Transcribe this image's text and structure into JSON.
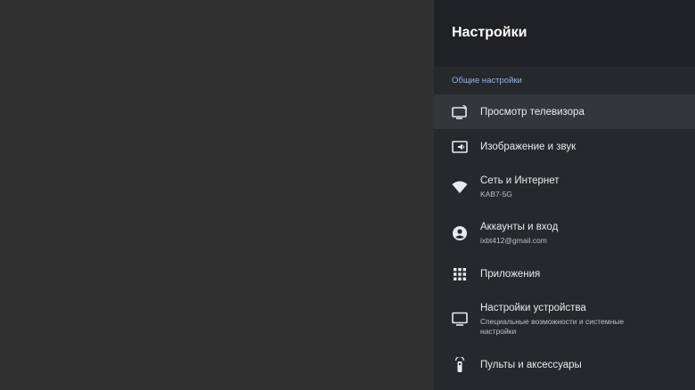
{
  "panel": {
    "title": "Настройки",
    "section_label": "Общие настройки"
  },
  "items": [
    {
      "label": "Просмотр телевизора",
      "icon": "tv-input-icon"
    },
    {
      "label": "Изображение и звук",
      "icon": "picture-sound-icon"
    },
    {
      "label": "Сеть и Интернет",
      "sub": "KAB7-5G",
      "icon": "wifi-icon"
    },
    {
      "label": "Аккаунты и вход",
      "sub": "ixbt412@gmail.com",
      "icon": "account-icon"
    },
    {
      "label": "Приложения",
      "icon": "apps-grid-icon"
    },
    {
      "label": "Настройки устройства",
      "sub": "Специальные возможности и системные настройки",
      "icon": "monitor-icon"
    },
    {
      "label": "Пульты и аксессуары",
      "icon": "remote-icon"
    }
  ],
  "colors": {
    "accent": "#8ab4f8",
    "panel_bg": "#27282b",
    "header_bg": "#202124",
    "focus_bg": "#35363a"
  }
}
